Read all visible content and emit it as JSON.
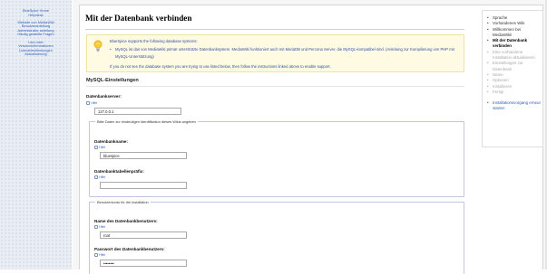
{
  "left_nav": {
    "group1": [
      "BlueSpice Home",
      "Helpdesk"
    ],
    "group2": [
      "Website von MediaWiki",
      "Benutzeranleitung",
      "Administrator-anleitung",
      "Häufig gestellte Fragen"
    ],
    "group3": [
      "Lies mich",
      "Versionsinformationen",
      "Lizenzbestimmungen",
      "Aktualisierung"
    ]
  },
  "page": {
    "title": "Mit der Datenbank verbinden"
  },
  "warning": {
    "icon": "lightbulb-icon",
    "heading": "BlueSpice supports the following database systems:",
    "bullet": "MySQL ist das von MediaWiki primär unterstützte Datenbanksystem. MediaWiki funktioniert auch mit MariaDB und Percona Server, die MySQL-kompatibel sind. (Anleitung zur Kompilierung von PHP mit MySQL-Unterstützung)",
    "footer": "If you do not see the database system you are trying to use listed below, then follow the instructions linked above to enable support."
  },
  "mysql_section": {
    "heading": "MySQL-Einstellungen",
    "server_label": "Datenbankserver:",
    "help_label": "Hilfe",
    "server_value": "127.0.0.1"
  },
  "identify_fieldset": {
    "legend": "Bitte Daten zur eindeutigen Identifikation dieses Wikis angeben",
    "dbname_label": "Datenbankname:",
    "dbname_help": "Hilfe",
    "dbname_value": "bluespice",
    "prefix_label": "Datenbanktabellenpräfix:",
    "prefix_help": "Hilfe",
    "prefix_value": ""
  },
  "account_fieldset": {
    "legend": "Benutzerkonto für die Installation",
    "user_label": "Name des Datenbankbenutzers:",
    "user_help": "Hilfe",
    "user_value": "root",
    "pass_label": "Passwort des Datenbankbenutzers:",
    "pass_help": "Hilfe",
    "pass_value": "password"
  },
  "steps": {
    "items": [
      {
        "label": "Sprache",
        "state": "done"
      },
      {
        "label": "Vorhandenes Wiki",
        "state": "done"
      },
      {
        "label": "Willkommen bei MediaWiki!",
        "state": "done"
      },
      {
        "label": "Mit der Datenbank verbinden",
        "state": "current"
      },
      {
        "label": "Eine vorhandene Installation aktualisieren",
        "state": "future"
      },
      {
        "label": "Einstellungen zur Datenbank",
        "state": "future"
      },
      {
        "label": "Name",
        "state": "future"
      },
      {
        "label": "Optionen",
        "state": "future"
      },
      {
        "label": "Installieren",
        "state": "future"
      },
      {
        "label": "Fertig!",
        "state": "future"
      }
    ],
    "restart": "Installationsvorgang erneut starten"
  },
  "colors": {
    "link": "#2f5db3",
    "warning_bg": "#fffbe3",
    "fieldset_border": "#bfc7e2"
  }
}
